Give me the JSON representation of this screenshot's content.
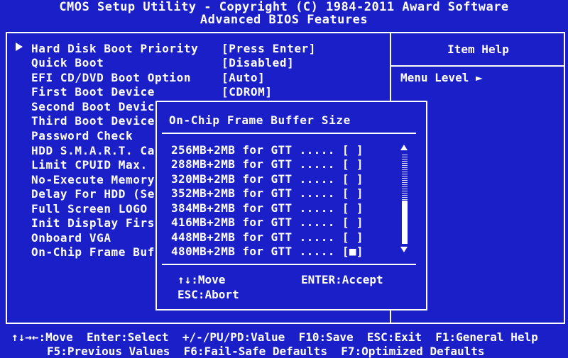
{
  "header": {
    "title": "CMOS Setup Utility - Copyright (C) 1984-2011 Award Software",
    "subtitle": "Advanced BIOS Features"
  },
  "menu": {
    "items": [
      {
        "label": "Hard Disk Boot Priority",
        "value": "[Press Enter]"
      },
      {
        "label": "Quick Boot",
        "value": "[Disabled]"
      },
      {
        "label": "EFI CD/DVD Boot Option",
        "value": "[Auto]"
      },
      {
        "label": "First Boot Device",
        "value": "[CDROM]"
      },
      {
        "label": "Second Boot Devic",
        "value": ""
      },
      {
        "label": "Third Boot Device",
        "value": ""
      },
      {
        "label": "Password Check",
        "value": ""
      },
      {
        "label": "HDD S.M.A.R.T. Ca",
        "value": ""
      },
      {
        "label": "Limit CPUID Max.",
        "value": ""
      },
      {
        "label": "No-Execute Memory",
        "value": ""
      },
      {
        "label": "Delay For HDD (Se",
        "value": ""
      },
      {
        "label": "Full Screen LOGO",
        "value": ""
      },
      {
        "label": "Init Display Firs",
        "value": ""
      },
      {
        "label": "Onboard VGA",
        "value": ""
      },
      {
        "label": "On-Chip Frame Buf",
        "value": ""
      }
    ]
  },
  "item_help": {
    "title": "Item Help",
    "menu_level": "Menu Level  ►"
  },
  "popup": {
    "title": "On-Chip Frame Buffer Size",
    "options": [
      {
        "label": "256MB+2MB for GTT .....",
        "mark": "[ ]"
      },
      {
        "label": "288MB+2MB for GTT .....",
        "mark": "[ ]"
      },
      {
        "label": "320MB+2MB for GTT .....",
        "mark": "[ ]"
      },
      {
        "label": "352MB+2MB for GTT .....",
        "mark": "[ ]"
      },
      {
        "label": "384MB+2MB for GTT .....",
        "mark": "[ ]"
      },
      {
        "label": "416MB+2MB for GTT .....",
        "mark": "[ ]"
      },
      {
        "label": "448MB+2MB for GTT .....",
        "mark": "[ ]"
      },
      {
        "label": "480MB+2MB for GTT .....",
        "mark": "[■]"
      }
    ],
    "help_move": "↑↓:Move",
    "help_enter": "ENTER:Accept",
    "help_abort": "ESC:Abort"
  },
  "footer": {
    "line1": "↑↓→←:Move  Enter:Select  +/-/PU/PD:Value  F10:Save  ESC:Exit  F1:General Help",
    "line2": "F5:Previous Values  F6:Fail-Safe Defaults  F7:Optimized Defaults"
  },
  "colors": {
    "background": "#1b1fc8",
    "foreground": "#ffffff"
  }
}
